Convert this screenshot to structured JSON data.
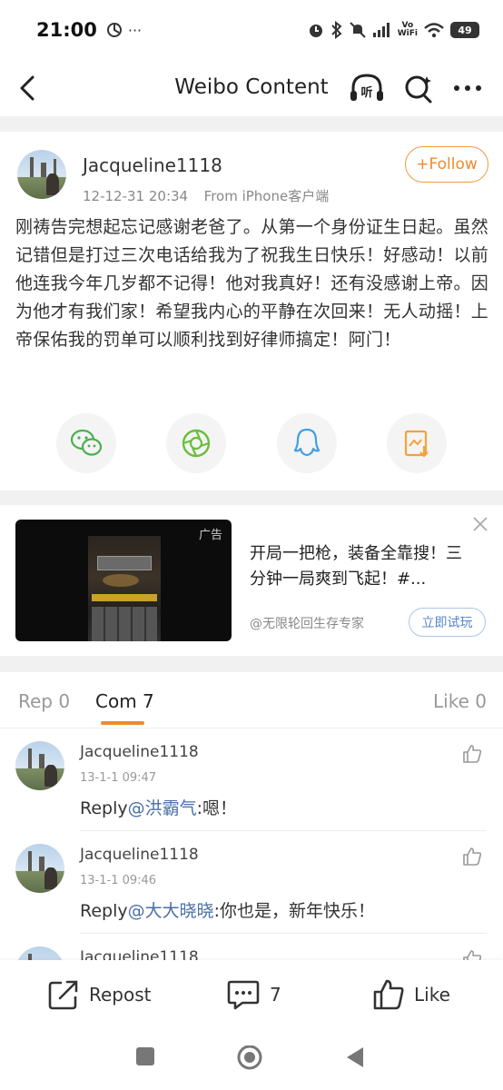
{
  "status_bar": {
    "time": "21:00",
    "extra": "···",
    "network_label": "Vo\nWiFi",
    "battery": "49"
  },
  "nav": {
    "title": "Weibo Content",
    "listen_label": "听"
  },
  "post": {
    "author": "Jacqueline1118",
    "timestamp": "12-12-31 20:34",
    "source": "From iPhone客户端",
    "follow_label": "+Follow",
    "text": "刚祷告完想起忘记感谢老爸了。从第一个身份证生日起。虽然记错但是打过三次电话给我为了祝我生日快乐！好感动！以前他连我今年几岁都不记得！他对我真好！还有没感谢上帝。因为他才有我们家！希望我内心的平静在次回来！无人动摇！上帝保佑我的罚单可以顺利找到好律师搞定！阿门！",
    "share": [
      {
        "icon": "wechat-icon",
        "color": "#4caf50"
      },
      {
        "icon": "moments-icon",
        "color": "#6abf3a"
      },
      {
        "icon": "qq-icon",
        "color": "#3fa0e6"
      },
      {
        "icon": "save-image-icon",
        "color": "#f2a33a"
      }
    ]
  },
  "ad": {
    "tag": "广告",
    "title": "开局一把枪，装备全靠搜！三分钟一局爽到飞起！#...",
    "source": "@无限轮回生存专家",
    "cta": "立即试玩"
  },
  "tabs": {
    "repost": "Rep 0",
    "comment": "Com 7",
    "like": "Like 0"
  },
  "comments": [
    {
      "name": "Jacqueline1118",
      "time": "13-1-1 09:47",
      "prefix": "Reply",
      "mention": "@洪霸气",
      "text": ":嗯！"
    },
    {
      "name": "Jacqueline1118",
      "time": "13-1-1 09:46",
      "prefix": "Reply",
      "mention": "@大大晓晓",
      "text": ":你也是，新年快乐！"
    },
    {
      "name": "Jacqueline1118",
      "time": "",
      "prefix": "",
      "mention": "",
      "text": ""
    }
  ],
  "bottom_bar": {
    "repost": "Repost",
    "comment_count": "7",
    "like": "Like"
  },
  "colors": {
    "accent": "#f08a2c",
    "link": "#4a6fa5",
    "divider": "#f1f1f1"
  }
}
